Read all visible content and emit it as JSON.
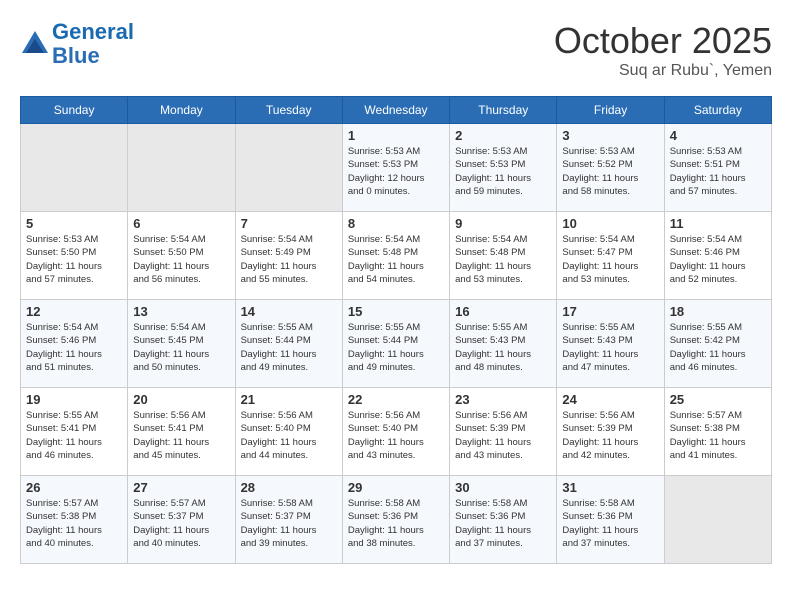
{
  "logo": {
    "line1": "General",
    "line2": "Blue"
  },
  "title": "October 2025",
  "subtitle": "Suq ar Rubu`, Yemen",
  "weekdays": [
    "Sunday",
    "Monday",
    "Tuesday",
    "Wednesday",
    "Thursday",
    "Friday",
    "Saturday"
  ],
  "weeks": [
    [
      {
        "day": "",
        "info": ""
      },
      {
        "day": "",
        "info": ""
      },
      {
        "day": "",
        "info": ""
      },
      {
        "day": "1",
        "info": "Sunrise: 5:53 AM\nSunset: 5:53 PM\nDaylight: 12 hours\nand 0 minutes."
      },
      {
        "day": "2",
        "info": "Sunrise: 5:53 AM\nSunset: 5:53 PM\nDaylight: 11 hours\nand 59 minutes."
      },
      {
        "day": "3",
        "info": "Sunrise: 5:53 AM\nSunset: 5:52 PM\nDaylight: 11 hours\nand 58 minutes."
      },
      {
        "day": "4",
        "info": "Sunrise: 5:53 AM\nSunset: 5:51 PM\nDaylight: 11 hours\nand 57 minutes."
      }
    ],
    [
      {
        "day": "5",
        "info": "Sunrise: 5:53 AM\nSunset: 5:50 PM\nDaylight: 11 hours\nand 57 minutes."
      },
      {
        "day": "6",
        "info": "Sunrise: 5:54 AM\nSunset: 5:50 PM\nDaylight: 11 hours\nand 56 minutes."
      },
      {
        "day": "7",
        "info": "Sunrise: 5:54 AM\nSunset: 5:49 PM\nDaylight: 11 hours\nand 55 minutes."
      },
      {
        "day": "8",
        "info": "Sunrise: 5:54 AM\nSunset: 5:48 PM\nDaylight: 11 hours\nand 54 minutes."
      },
      {
        "day": "9",
        "info": "Sunrise: 5:54 AM\nSunset: 5:48 PM\nDaylight: 11 hours\nand 53 minutes."
      },
      {
        "day": "10",
        "info": "Sunrise: 5:54 AM\nSunset: 5:47 PM\nDaylight: 11 hours\nand 53 minutes."
      },
      {
        "day": "11",
        "info": "Sunrise: 5:54 AM\nSunset: 5:46 PM\nDaylight: 11 hours\nand 52 minutes."
      }
    ],
    [
      {
        "day": "12",
        "info": "Sunrise: 5:54 AM\nSunset: 5:46 PM\nDaylight: 11 hours\nand 51 minutes."
      },
      {
        "day": "13",
        "info": "Sunrise: 5:54 AM\nSunset: 5:45 PM\nDaylight: 11 hours\nand 50 minutes."
      },
      {
        "day": "14",
        "info": "Sunrise: 5:55 AM\nSunset: 5:44 PM\nDaylight: 11 hours\nand 49 minutes."
      },
      {
        "day": "15",
        "info": "Sunrise: 5:55 AM\nSunset: 5:44 PM\nDaylight: 11 hours\nand 49 minutes."
      },
      {
        "day": "16",
        "info": "Sunrise: 5:55 AM\nSunset: 5:43 PM\nDaylight: 11 hours\nand 48 minutes."
      },
      {
        "day": "17",
        "info": "Sunrise: 5:55 AM\nSunset: 5:43 PM\nDaylight: 11 hours\nand 47 minutes."
      },
      {
        "day": "18",
        "info": "Sunrise: 5:55 AM\nSunset: 5:42 PM\nDaylight: 11 hours\nand 46 minutes."
      }
    ],
    [
      {
        "day": "19",
        "info": "Sunrise: 5:55 AM\nSunset: 5:41 PM\nDaylight: 11 hours\nand 46 minutes."
      },
      {
        "day": "20",
        "info": "Sunrise: 5:56 AM\nSunset: 5:41 PM\nDaylight: 11 hours\nand 45 minutes."
      },
      {
        "day": "21",
        "info": "Sunrise: 5:56 AM\nSunset: 5:40 PM\nDaylight: 11 hours\nand 44 minutes."
      },
      {
        "day": "22",
        "info": "Sunrise: 5:56 AM\nSunset: 5:40 PM\nDaylight: 11 hours\nand 43 minutes."
      },
      {
        "day": "23",
        "info": "Sunrise: 5:56 AM\nSunset: 5:39 PM\nDaylight: 11 hours\nand 43 minutes."
      },
      {
        "day": "24",
        "info": "Sunrise: 5:56 AM\nSunset: 5:39 PM\nDaylight: 11 hours\nand 42 minutes."
      },
      {
        "day": "25",
        "info": "Sunrise: 5:57 AM\nSunset: 5:38 PM\nDaylight: 11 hours\nand 41 minutes."
      }
    ],
    [
      {
        "day": "26",
        "info": "Sunrise: 5:57 AM\nSunset: 5:38 PM\nDaylight: 11 hours\nand 40 minutes."
      },
      {
        "day": "27",
        "info": "Sunrise: 5:57 AM\nSunset: 5:37 PM\nDaylight: 11 hours\nand 40 minutes."
      },
      {
        "day": "28",
        "info": "Sunrise: 5:58 AM\nSunset: 5:37 PM\nDaylight: 11 hours\nand 39 minutes."
      },
      {
        "day": "29",
        "info": "Sunrise: 5:58 AM\nSunset: 5:36 PM\nDaylight: 11 hours\nand 38 minutes."
      },
      {
        "day": "30",
        "info": "Sunrise: 5:58 AM\nSunset: 5:36 PM\nDaylight: 11 hours\nand 37 minutes."
      },
      {
        "day": "31",
        "info": "Sunrise: 5:58 AM\nSunset: 5:36 PM\nDaylight: 11 hours\nand 37 minutes."
      },
      {
        "day": "",
        "info": ""
      }
    ]
  ]
}
